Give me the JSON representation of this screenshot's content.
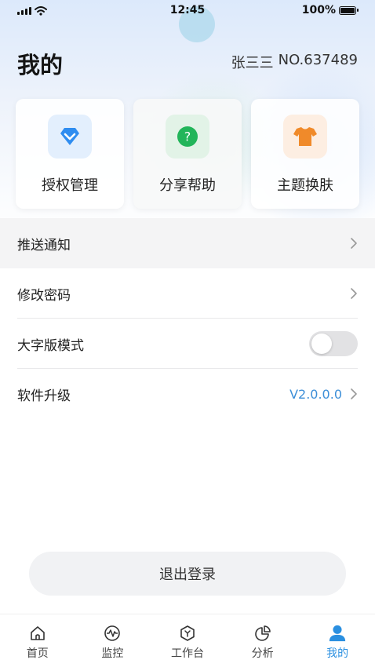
{
  "status_bar": {
    "time": "12:45",
    "battery": "100%"
  },
  "header": {
    "title": "我的",
    "user_name": "张三三",
    "user_no": "NO.637489"
  },
  "cards": [
    {
      "label": "授权管理",
      "icon": "diamond-icon",
      "color": "#2f8df0"
    },
    {
      "label": "分享帮助",
      "icon": "question-icon",
      "color": "#22b55a"
    },
    {
      "label": "主题换肤",
      "icon": "tshirt-icon",
      "color": "#f08a2a"
    }
  ],
  "settings": {
    "push_notification": "推送通知",
    "change_password": "修改密码",
    "large_font_mode": "大字版模式",
    "software_upgrade": "软件升级",
    "version": "V2.0.0.0"
  },
  "logout_label": "退出登录",
  "tabs": [
    {
      "label": "首页",
      "icon": "home-icon"
    },
    {
      "label": "监控",
      "icon": "monitor-icon"
    },
    {
      "label": "工作台",
      "icon": "workbench-icon"
    },
    {
      "label": "分析",
      "icon": "pie-chart-icon"
    },
    {
      "label": "我的",
      "icon": "user-icon",
      "active": true
    }
  ],
  "colors": {
    "accent": "#2a8fe0",
    "version_text": "#3d8fd8"
  }
}
